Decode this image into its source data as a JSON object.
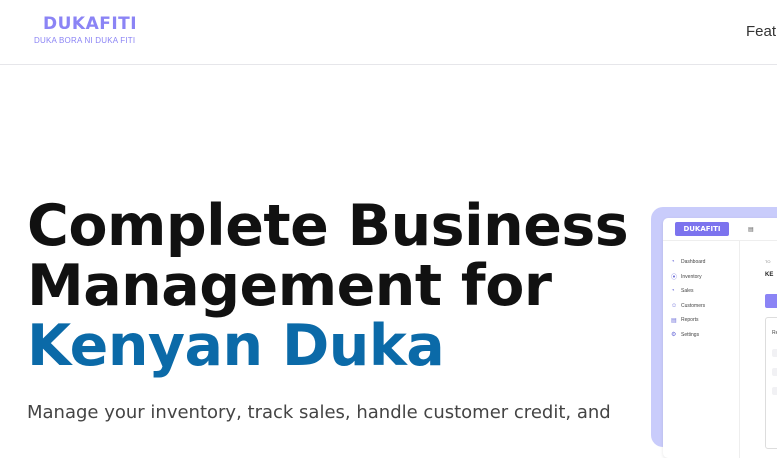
{
  "header": {
    "logo": {
      "name": "DUKAFITI",
      "tagline": "DUKA BORA NI DUKA FITI"
    },
    "nav": {
      "features_label": "Feat"
    }
  },
  "hero": {
    "title_line1": "Complete Business",
    "title_line2": "Management for",
    "title_accent": "Kenyan Duka",
    "subtitle": "Manage your inventory, track sales, handle customer credit, and"
  },
  "preview": {
    "logo": "DUKAFITI",
    "grid_label": "▤",
    "nav": [
      {
        "icon": "◔",
        "label": "Dashboard"
      },
      {
        "icon": "⦿",
        "label": "Inventory"
      },
      {
        "icon": "◔",
        "label": "Sales"
      },
      {
        "icon": "☺",
        "label": "Customers"
      },
      {
        "icon": "▤",
        "label": "Reports"
      },
      {
        "icon": "⚙",
        "label": "Settings"
      }
    ],
    "right_small": "TO",
    "right_bold": "KE",
    "card_title": "Re"
  },
  "colors": {
    "brand": "#8b84f5",
    "accent": "#0b6aa8",
    "title": "#111111",
    "preview_frame": "#c9ccfb"
  }
}
